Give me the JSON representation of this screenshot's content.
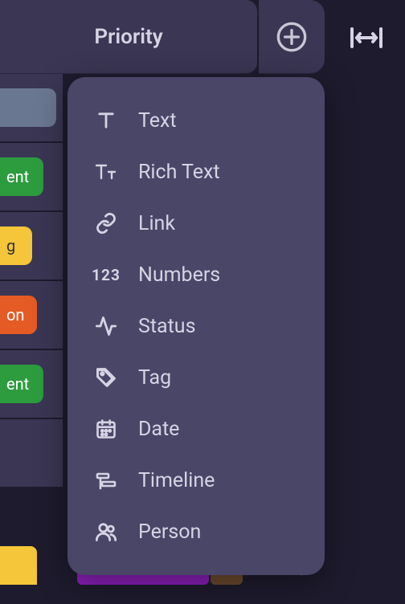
{
  "column_header": "Priority",
  "row_chips": [
    {
      "color": "gray",
      "text": ""
    },
    {
      "color": "green",
      "text": "ent"
    },
    {
      "color": "yellow",
      "text": "g"
    },
    {
      "color": "orange",
      "text": "on"
    },
    {
      "color": "green",
      "text": "ent"
    },
    {
      "color": "",
      "text": ""
    }
  ],
  "menu": {
    "items": [
      {
        "icon": "text-icon",
        "label": "Text"
      },
      {
        "icon": "rich-text-icon",
        "label": "Rich Text"
      },
      {
        "icon": "link-icon",
        "label": "Link"
      },
      {
        "icon": "numbers-icon",
        "label": "Numbers"
      },
      {
        "icon": "status-icon",
        "label": "Status"
      },
      {
        "icon": "tag-icon",
        "label": "Tag"
      },
      {
        "icon": "date-icon",
        "label": "Date"
      },
      {
        "icon": "timeline-icon",
        "label": "Timeline"
      },
      {
        "icon": "person-icon",
        "label": "Person"
      }
    ]
  }
}
